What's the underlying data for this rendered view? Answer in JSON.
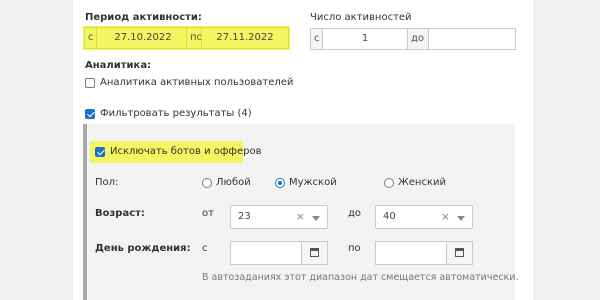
{
  "activity_period": {
    "label": "Период активности:",
    "from_prefix": "с",
    "from_value": "27.10.2022",
    "to_prefix": "по",
    "to_value": "27.11.2022"
  },
  "activity_count": {
    "label": "Число активностей",
    "from_prefix": "с",
    "from_value": "1",
    "to_prefix": "до",
    "to_value": ""
  },
  "analytics": {
    "label": "Аналитика:",
    "checkbox_label": "Аналитика активных пользователей",
    "checked": false
  },
  "filter": {
    "checkbox_label": "Фильтровать результаты (4)",
    "checked": true
  },
  "exclude_bots": {
    "checkbox_label": "Исключать ботов и офферов",
    "checked": true
  },
  "gender": {
    "label": "Пол:",
    "options": [
      "Любой",
      "Мужской",
      "Женский"
    ],
    "selected": "Мужской"
  },
  "age": {
    "label": "Возраст:",
    "from_prefix": "от",
    "from_value": "23",
    "to_prefix": "до",
    "to_value": "40"
  },
  "birthday": {
    "label": "День рождения:",
    "from_prefix": "с",
    "from_value": "",
    "to_prefix": "по",
    "to_value": "",
    "hint": "В автозаданиях этот диапазон дат смещается автоматически."
  },
  "colors": {
    "highlight": "#f3f561",
    "accent": "#1a73c8"
  }
}
